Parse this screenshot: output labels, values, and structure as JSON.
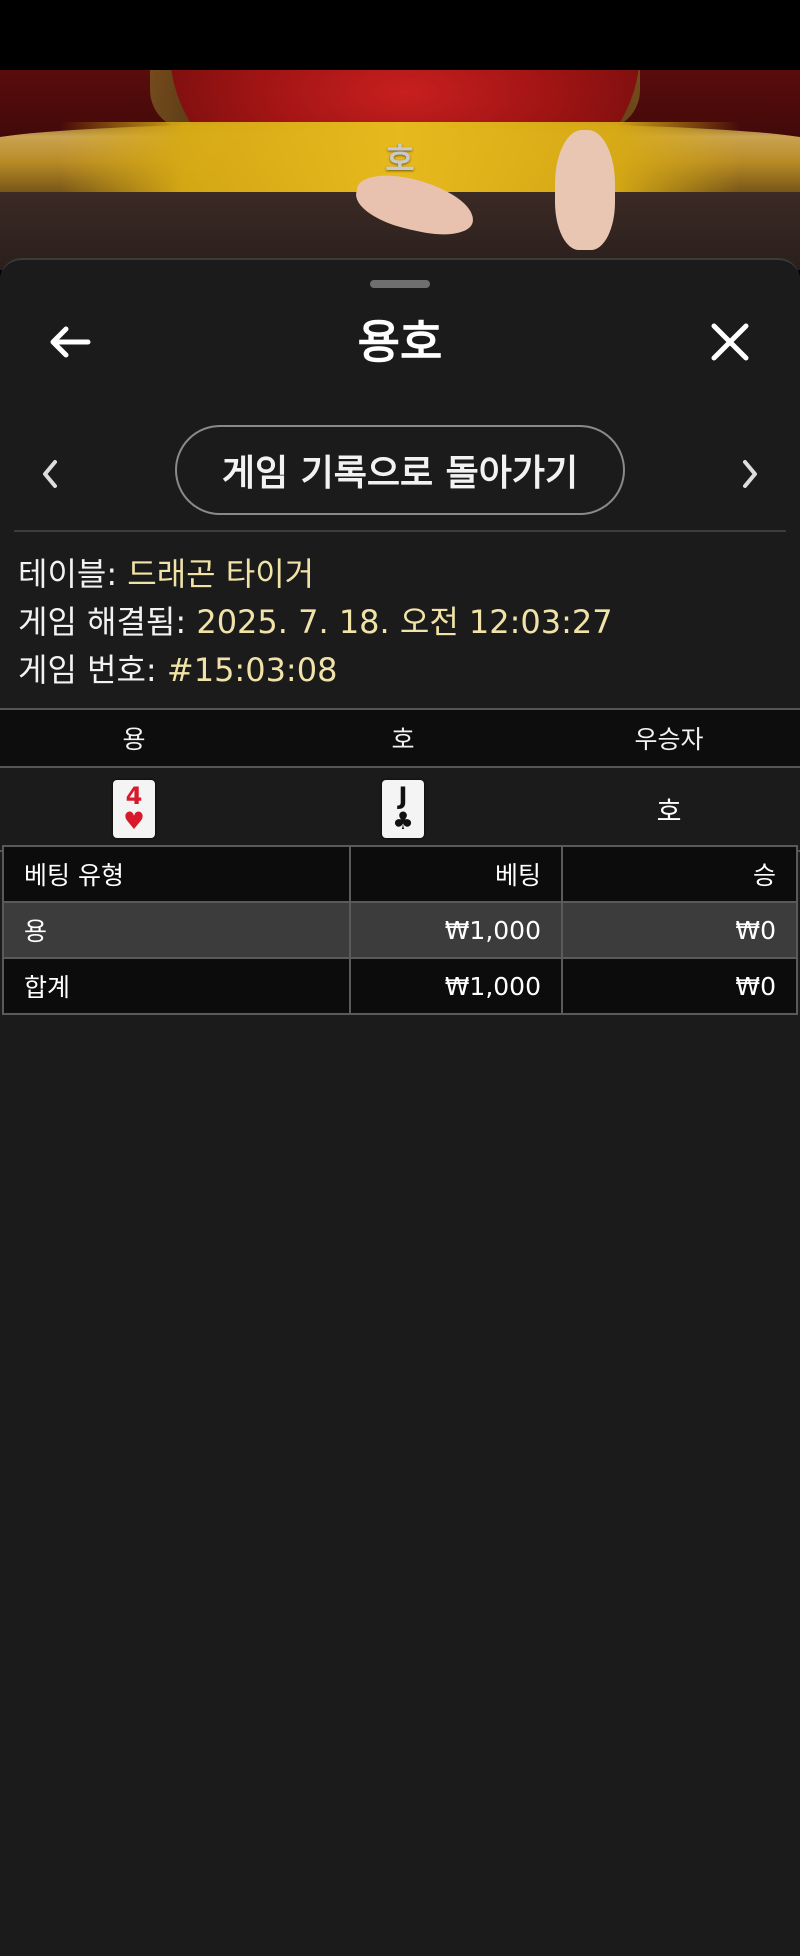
{
  "video": {
    "banner_text": "호"
  },
  "header": {
    "title": "용호"
  },
  "navigation": {
    "back_to_history_label": "게임 기록으로 돌아가기"
  },
  "info": {
    "table_label": "테이블:",
    "table_value": "드래곤 타이거",
    "resolved_label": "게임 해결됨:",
    "resolved_value": "2025. 7. 18. 오전 12:03:27",
    "game_number_label": "게임 번호:",
    "game_number_value": "#15:03:08"
  },
  "result": {
    "headers": [
      "용",
      "호",
      "우승자"
    ],
    "dragon_card": {
      "rank": "4",
      "suit": "♥"
    },
    "tiger_card": {
      "rank": "J",
      "suit": "♣"
    },
    "winner": "호"
  },
  "bets": {
    "headers": [
      "베팅 유형",
      "베팅",
      "승"
    ],
    "rows": [
      {
        "type": "용",
        "bet": "₩1,000",
        "win": "₩0"
      }
    ],
    "total": {
      "type": "합계",
      "bet": "₩1,000",
      "win": "₩0"
    }
  },
  "colors": {
    "accent_value": "#f1e3a8",
    "card_red": "#d8192c",
    "sheet_bg": "#1b1b1b"
  },
  "icons": [
    "back-arrow-icon",
    "close-icon",
    "chevron-left-icon",
    "chevron-right-icon"
  ]
}
